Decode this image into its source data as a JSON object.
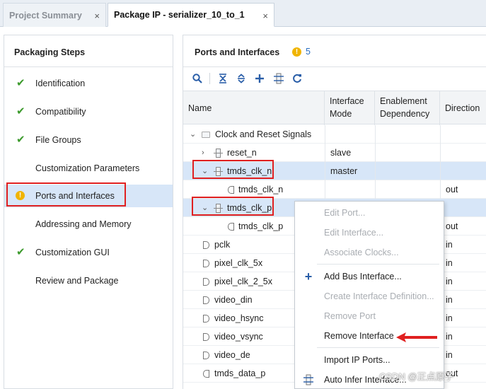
{
  "tabs": [
    {
      "label": "Project Summary",
      "active": false
    },
    {
      "label": "Package IP - serializer_10_to_1",
      "active": true
    }
  ],
  "tab_close_glyph": "×",
  "left_panel": {
    "title": "Packaging Steps",
    "steps": [
      {
        "label": "Identification",
        "status": "check"
      },
      {
        "label": "Compatibility",
        "status": "check"
      },
      {
        "label": "File Groups",
        "status": "check"
      },
      {
        "label": "Customization Parameters",
        "status": "none"
      },
      {
        "label": "Ports and Interfaces",
        "status": "warning",
        "selected": true
      },
      {
        "label": "Addressing and Memory",
        "status": "none"
      },
      {
        "label": "Customization GUI",
        "status": "check"
      },
      {
        "label": "Review and Package",
        "status": "none"
      }
    ],
    "check_glyph": "✔",
    "warning_glyph": "!"
  },
  "right_panel": {
    "title": "Ports and Interfaces",
    "warning_count": "5",
    "toolbar_icons": [
      "search-icon",
      "collapse-all-icon",
      "expand-all-icon",
      "add-icon",
      "auto-infer-icon",
      "refresh-icon"
    ],
    "columns": [
      {
        "line1": "Name",
        "line2": ""
      },
      {
        "line1": "Interface",
        "line2": "Mode"
      },
      {
        "line1": "Enablement",
        "line2": "Dependency"
      },
      {
        "line1": "Direction",
        "line2": ""
      }
    ],
    "rows": [
      {
        "name": "Clock and Reset Signals",
        "mode": "",
        "direction": "",
        "kind": "folder",
        "expand": "open"
      },
      {
        "name": "reset_n",
        "mode": "slave",
        "direction": "",
        "kind": "interface",
        "expand": "closed"
      },
      {
        "name": "tmds_clk_n",
        "mode": "master",
        "direction": "",
        "kind": "interface",
        "expand": "open",
        "selected": true
      },
      {
        "name": "tmds_clk_n",
        "mode": "",
        "direction": "out",
        "kind": "port-out"
      },
      {
        "name": "tmds_clk_p",
        "mode": "",
        "direction": "",
        "kind": "interface",
        "expand": "open",
        "selected": true
      },
      {
        "name": "tmds_clk_p",
        "mode": "",
        "direction": "out",
        "kind": "port-out"
      },
      {
        "name": "pclk",
        "mode": "",
        "direction": "in",
        "kind": "port-in"
      },
      {
        "name": "pixel_clk_5x",
        "mode": "",
        "direction": "in",
        "kind": "port-in"
      },
      {
        "name": "pixel_clk_2_5x",
        "mode": "",
        "direction": "in",
        "kind": "port-in"
      },
      {
        "name": "video_din",
        "mode": "",
        "direction": "in",
        "kind": "port-in"
      },
      {
        "name": "video_hsync",
        "mode": "",
        "direction": "in",
        "kind": "port-in"
      },
      {
        "name": "video_vsync",
        "mode": "",
        "direction": "in",
        "kind": "port-in"
      },
      {
        "name": "video_de",
        "mode": "",
        "direction": "in",
        "kind": "port-in"
      },
      {
        "name": "tmds_data_p",
        "mode": "",
        "direction": "out",
        "kind": "port-out"
      }
    ]
  },
  "context_menu": {
    "items": [
      {
        "label": "Edit Port...",
        "enabled": false,
        "icon": ""
      },
      {
        "label": "Edit Interface...",
        "enabled": false,
        "icon": ""
      },
      {
        "label": "Associate Clocks...",
        "enabled": false,
        "icon": ""
      },
      {
        "label": "Add Bus Interface...",
        "enabled": true,
        "icon": "add-icon",
        "glyph": "+"
      },
      {
        "label": "Create Interface Definition...",
        "enabled": false,
        "icon": ""
      },
      {
        "label": "Remove Port",
        "enabled": false,
        "icon": ""
      },
      {
        "label": "Remove Interface",
        "enabled": true,
        "icon": ""
      },
      {
        "label": "Import IP Ports...",
        "enabled": true,
        "icon": ""
      },
      {
        "label": "Auto Infer Interface...",
        "enabled": true,
        "icon": "auto-infer-icon"
      }
    ]
  },
  "watermark": "CSDN @正点原子",
  "colors": {
    "selection": "#d7e6f8",
    "highlight_box": "#e02020",
    "check": "#3c9a2c",
    "warning": "#f0b400",
    "icon_blue": "#2a5ea8"
  }
}
